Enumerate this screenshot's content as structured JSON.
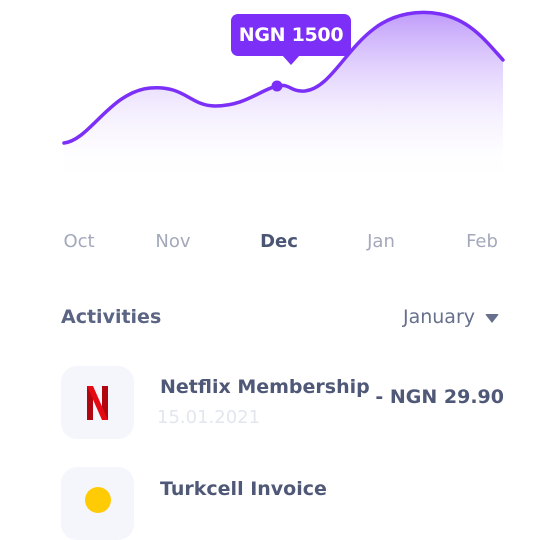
{
  "tooltip": {
    "label": "NGN 1500"
  },
  "months": [
    "Oct",
    "Nov",
    "Dec",
    "Jan",
    "Feb"
  ],
  "active_month": "Dec",
  "activities": {
    "title": "Activities",
    "filter": {
      "selected": "January",
      "icon": "caret-down-icon"
    }
  },
  "items": [
    {
      "name": "Netflix Membership",
      "date": "15.01.2021",
      "amount": "- NGN 29.90",
      "icon": "netflix-logo-icon"
    },
    {
      "name": "Turkcell Invoice",
      "icon": "turkcell-logo-icon"
    }
  ],
  "colors": {
    "accent": "#7b2ff7",
    "area_top": "#c6a6fb",
    "text_dark": "#4f5877",
    "text_muted": "#a3a9bb",
    "netflix_red": "#e50914",
    "turkcell_yellow": "#ffcb05"
  }
}
